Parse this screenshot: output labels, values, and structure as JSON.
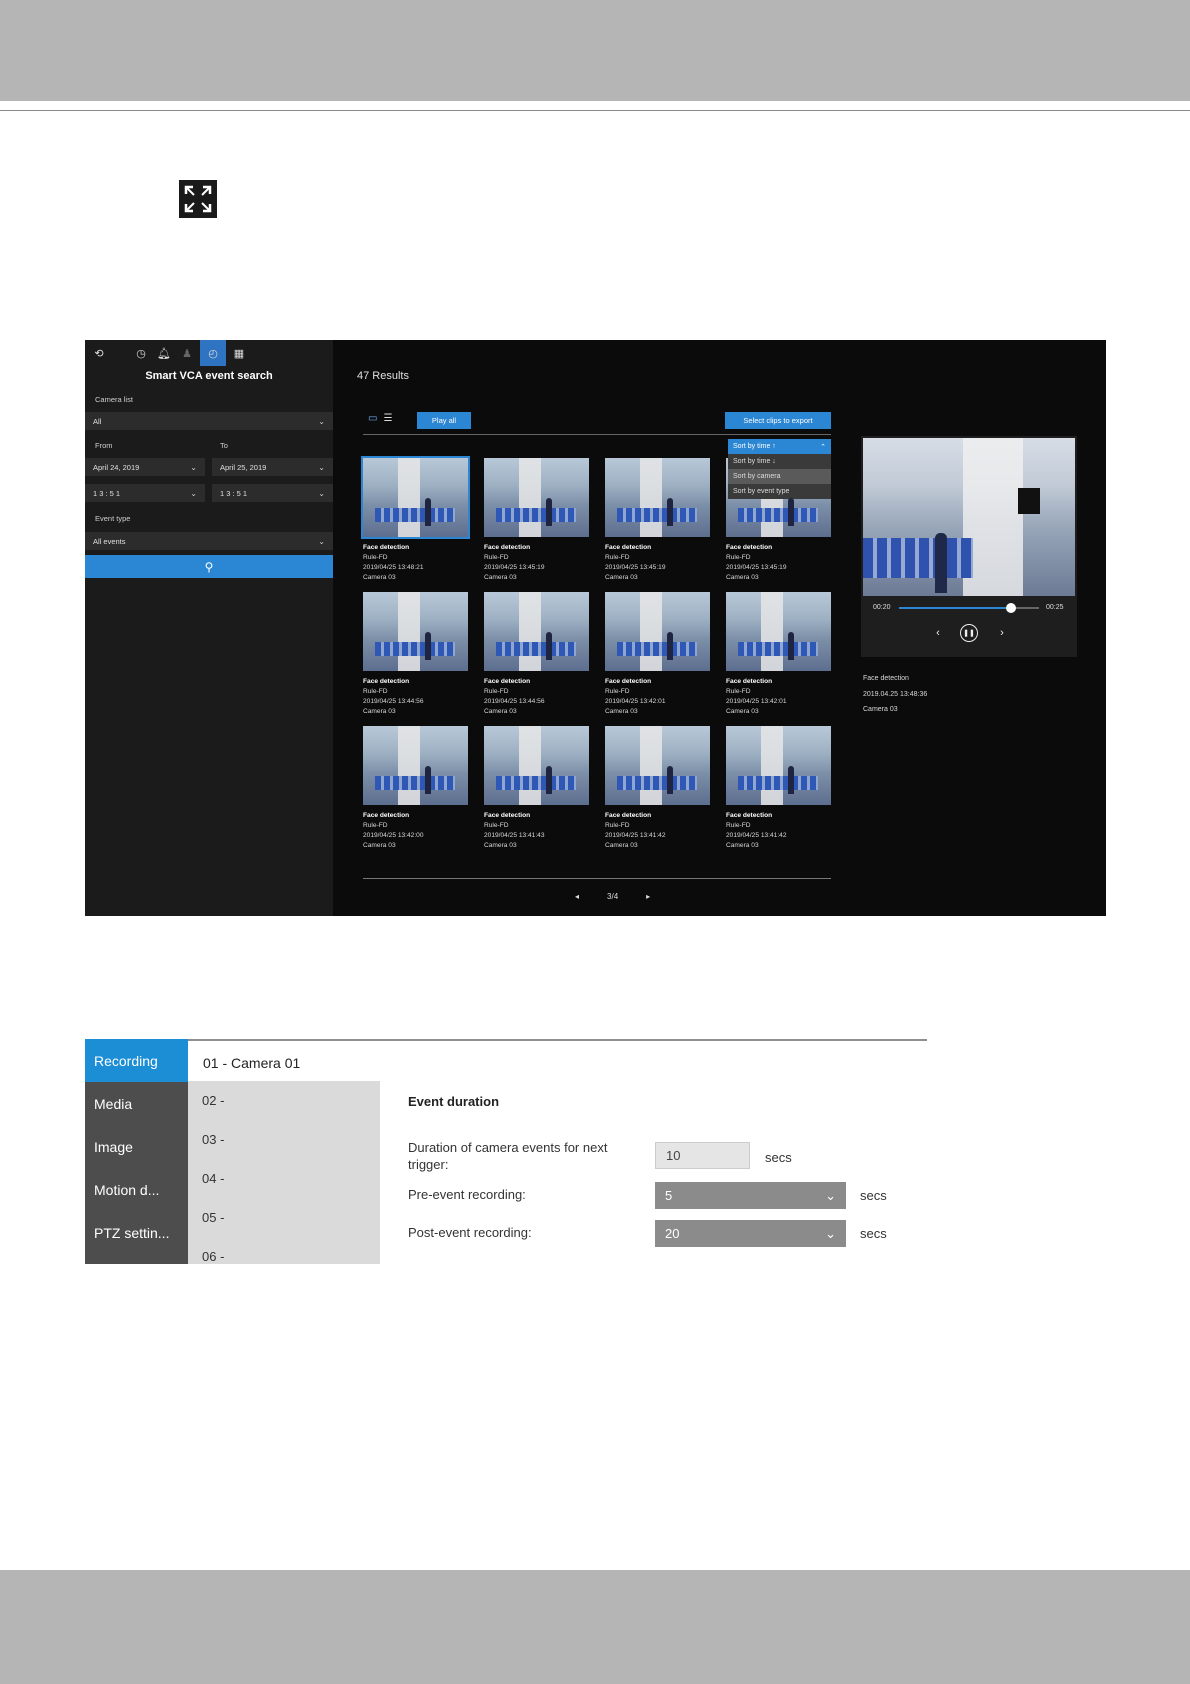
{
  "fullscreen_icon": "fullscreen-icon",
  "app1": {
    "panel_title": "Smart VCA event search",
    "camera_list_label": "Camera list",
    "camera_value": "All",
    "from_label": "From",
    "to_label": "To",
    "from_date": "April 24, 2019",
    "to_date": "April 25, 2019",
    "from_time": "1 3 : 5 1",
    "to_time": "1 3 : 5 1",
    "event_type_label": "Event type",
    "event_type_value": "All events",
    "results": "47 Results",
    "play_all": "Play all",
    "export": "Select clips to export",
    "sort_options": [
      "Sort by time ↑",
      "Sort by time ↓",
      "Sort by camera",
      "Sort by event type"
    ],
    "cards": [
      {
        "title": "Face detection",
        "rule": "Rule-FD",
        "time": "2019/04/25 13:48:21",
        "camera": "Camera 03"
      },
      {
        "title": "Face detection",
        "rule": "Rule-FD",
        "time": "2019/04/25 13:45:19",
        "camera": "Camera 03"
      },
      {
        "title": "Face detection",
        "rule": "Rule-FD",
        "time": "2019/04/25 13:45:19",
        "camera": "Camera 03"
      },
      {
        "title": "Face detection",
        "rule": "Rule-FD",
        "time": "2019/04/25 13:45:19",
        "camera": "Camera 03"
      },
      {
        "title": "Face detection",
        "rule": "Rule-FD",
        "time": "2019/04/25 13:44:56",
        "camera": "Camera 03"
      },
      {
        "title": "Face detection",
        "rule": "Rule-FD",
        "time": "2019/04/25 13:44:56",
        "camera": "Camera 03"
      },
      {
        "title": "Face detection",
        "rule": "Rule-FD",
        "time": "2019/04/25 13:42:01",
        "camera": "Camera 03"
      },
      {
        "title": "Face detection",
        "rule": "Rule-FD",
        "time": "2019/04/25 13:42:01",
        "camera": "Camera 03"
      },
      {
        "title": "Face detection",
        "rule": "Rule-FD",
        "time": "2019/04/25 13:42:00",
        "camera": "Camera 03"
      },
      {
        "title": "Face detection",
        "rule": "Rule-FD",
        "time": "2019/04/25 13:41:43",
        "camera": "Camera 03"
      },
      {
        "title": "Face detection",
        "rule": "Rule-FD",
        "time": "2019/04/25 13:41:42",
        "camera": "Camera 03"
      },
      {
        "title": "Face detection",
        "rule": "Rule-FD",
        "time": "2019/04/25 13:41:42",
        "camera": "Camera 03"
      }
    ],
    "page": "3/4",
    "player": {
      "start": "00:20",
      "end": "00:25",
      "progress": 0.8
    },
    "detail": {
      "title": "Face detection",
      "time": "2019.04.25 13:48:36",
      "camera": "Camera 03"
    }
  },
  "app2": {
    "sidebar": [
      "Recording",
      "Media",
      "Image",
      "Motion d...",
      "PTZ settin..."
    ],
    "camera_header": "01 - Camera 01",
    "cameras": [
      "02 -",
      "03 -",
      "04 -",
      "05 -",
      "06 -"
    ],
    "section_title": "Event duration",
    "duration_label": "Duration of camera events for next trigger:",
    "duration_value": "10",
    "pre_label": "Pre-event recording:",
    "pre_value": "5",
    "post_label": "Post-event recording:",
    "post_value": "20",
    "unit": "secs"
  },
  "colors": {
    "accent": "#2b86d4",
    "tab_active": "#1b8ed6"
  }
}
